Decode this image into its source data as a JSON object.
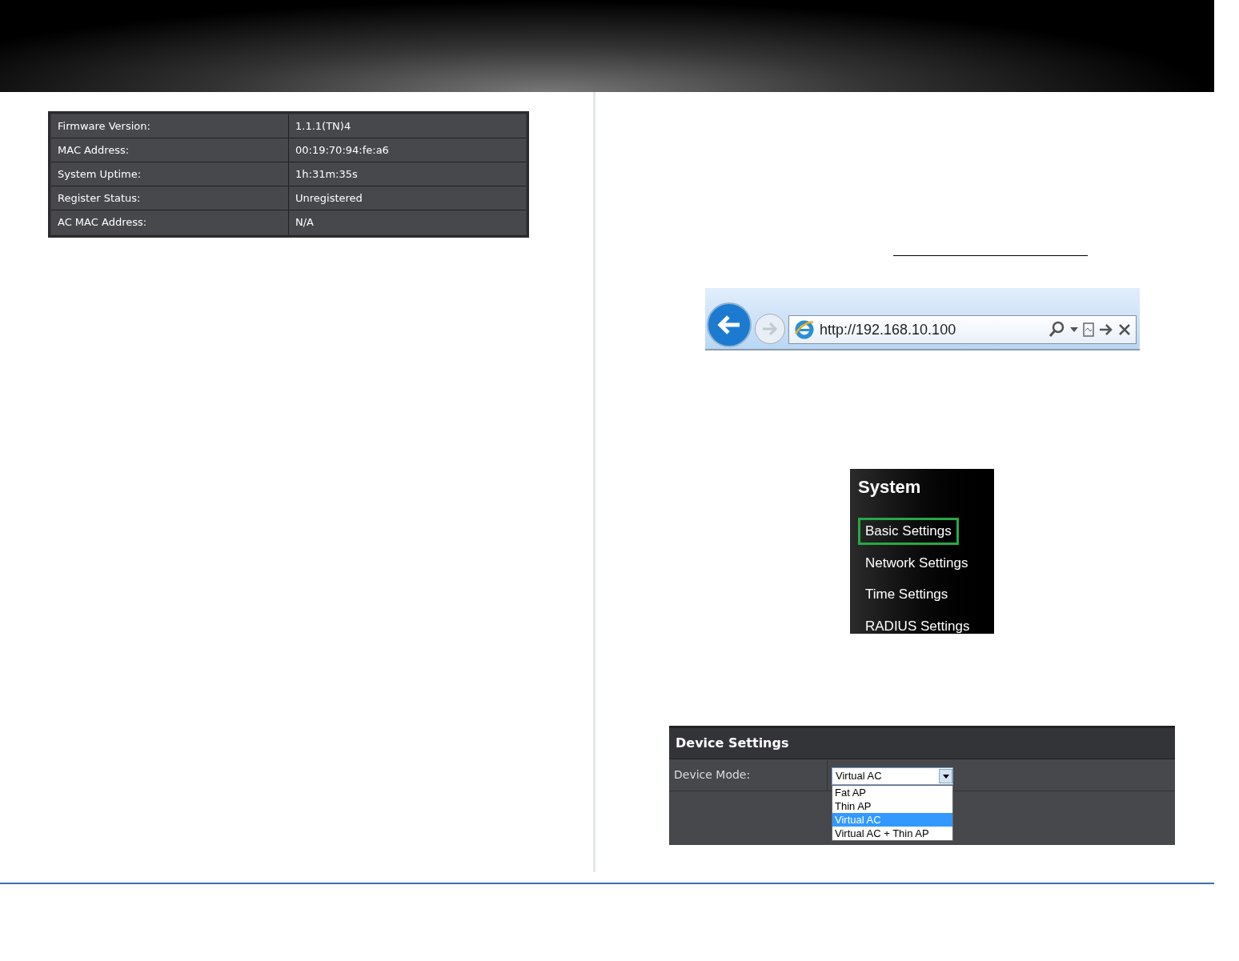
{
  "status_table": {
    "rows": [
      {
        "label": "Firmware Version:",
        "value": "1.1.1(TN)4"
      },
      {
        "label": "MAC Address:",
        "value": "00:19:70:94:fe:a6"
      },
      {
        "label": "System Uptime:",
        "value": "1h:31m:35s"
      },
      {
        "label": "Register Status:",
        "value": "Unregistered"
      },
      {
        "label": "AC MAC Address:",
        "value": "N/A"
      }
    ]
  },
  "browser_bar": {
    "url": "http://192.168.10.100"
  },
  "system_menu": {
    "title": "System",
    "items": [
      {
        "label": "Basic Settings",
        "selected": true
      },
      {
        "label": "Network Settings",
        "selected": false
      },
      {
        "label": "Time Settings",
        "selected": false
      },
      {
        "label": "RADIUS Settings",
        "selected": false
      }
    ]
  },
  "device_settings": {
    "title": "Device Settings",
    "field_label": "Device Mode:",
    "value": "Virtual AC",
    "options": [
      {
        "label": "Fat AP",
        "selected": false
      },
      {
        "label": "Thin AP",
        "selected": false
      },
      {
        "label": "Virtual AC",
        "selected": true
      },
      {
        "label": "Virtual AC + Thin AP",
        "selected": false
      }
    ]
  }
}
